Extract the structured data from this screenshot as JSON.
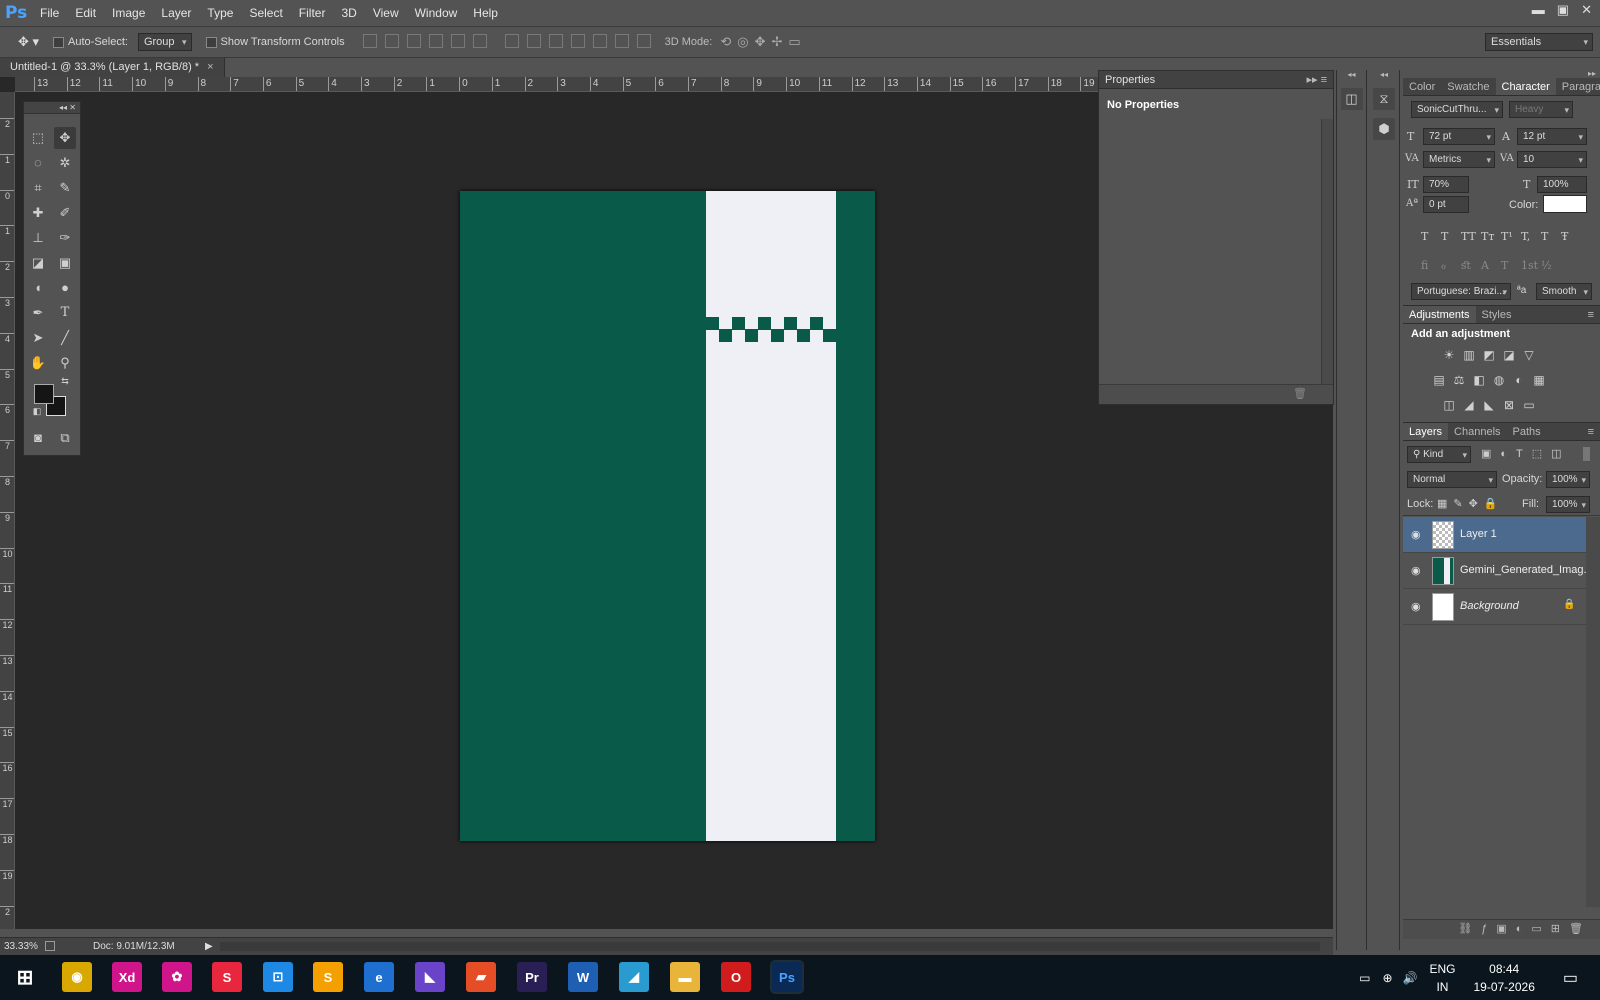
{
  "app": {
    "logo": "Ps",
    "menus": [
      "File",
      "Edit",
      "Image",
      "Layer",
      "Type",
      "Select",
      "Filter",
      "3D",
      "View",
      "Window",
      "Help"
    ]
  },
  "window_controls": {
    "minimize": "▬",
    "restore": "▣",
    "close": "✕"
  },
  "options": {
    "auto_select_label": "Auto-Select:",
    "auto_select_value": "Group",
    "show_transform_label": "Show Transform Controls",
    "mode_3d_label": "3D Mode:",
    "workspace": "Essentials"
  },
  "document": {
    "tab_title": "Untitled-1 @ 33.3% (Layer 1, RGB/8) *",
    "tab_close": "×",
    "ruler_top": [
      "13",
      "12",
      "11",
      "10",
      "9",
      "8",
      "7",
      "6",
      "5",
      "4",
      "3",
      "2",
      "1",
      "0",
      "1",
      "2",
      "3",
      "4",
      "5",
      "6",
      "7",
      "8",
      "9",
      "10",
      "11",
      "12",
      "13",
      "14",
      "15",
      "16",
      "17",
      "18",
      "19"
    ],
    "ruler_left": [
      "2",
      "1",
      "0",
      "1",
      "2",
      "3",
      "4",
      "5",
      "6",
      "7",
      "8",
      "9",
      "10",
      "11",
      "12",
      "13",
      "14",
      "15",
      "16",
      "17",
      "18",
      "19",
      "2"
    ],
    "canvas_green": "#0a5a4a",
    "canvas_white": "#eef0f6"
  },
  "status": {
    "zoom": "33.33%",
    "doc": "Doc: 9.01M/12.3M"
  },
  "properties": {
    "title": "Properties",
    "body": "No Properties"
  },
  "character": {
    "tabs": [
      "Color",
      "Swatche",
      "Character",
      "Paragra"
    ],
    "font_family": "SonicCutThru...",
    "font_style": "Heavy",
    "font_size": "72 pt",
    "leading": "12 pt",
    "kerning": "Metrics",
    "tracking": "10",
    "vscale": "70%",
    "hscale": "100%",
    "baseline": "0 pt",
    "color_label": "Color:",
    "type_styles": [
      "T",
      "T",
      "TT",
      "Tт",
      "T¹",
      "T,",
      "T",
      "Ŧ"
    ],
    "opentype": [
      "ﬁ",
      "ℴ",
      "ﬆ",
      "A",
      "T",
      "1st",
      "½"
    ],
    "language": "Portuguese: Brazi...",
    "aa_label": "ªa",
    "antialias": "Smooth"
  },
  "adjustments": {
    "tabs": [
      "Adjustments",
      "Styles"
    ],
    "title": "Add an adjustment",
    "row1": [
      "☀",
      "▥",
      "◩",
      "◪",
      "▽"
    ],
    "row2": [
      "▤",
      "⚖",
      "◧",
      "◍",
      "◐",
      "▦"
    ],
    "row3": [
      "◫",
      "◢",
      "◣",
      "⊠",
      "▭"
    ]
  },
  "layers": {
    "tabs": [
      "Layers",
      "Channels",
      "Paths"
    ],
    "filter": "Kind",
    "blend": "Normal",
    "opacity_label": "Opacity:",
    "opacity": "100%",
    "lock_label": "Lock:",
    "fill_label": "Fill:",
    "fill": "100%",
    "items": [
      {
        "name": "Layer 1",
        "selected": true
      },
      {
        "name": "Gemini_Generated_Imag...",
        "selected": false
      },
      {
        "name": "Background",
        "selected": false
      }
    ]
  },
  "taskbar": {
    "apps": [
      "⊞",
      "◉",
      "Xd",
      "✿",
      "S",
      "⊡",
      "S",
      "e",
      "◣",
      "▰",
      "Pr",
      "W",
      "◢",
      "▬",
      "O",
      "Ps"
    ],
    "lang_top": "ENG",
    "lang_bottom": "IN",
    "time": "08:44",
    "date": "19-07-2026"
  }
}
